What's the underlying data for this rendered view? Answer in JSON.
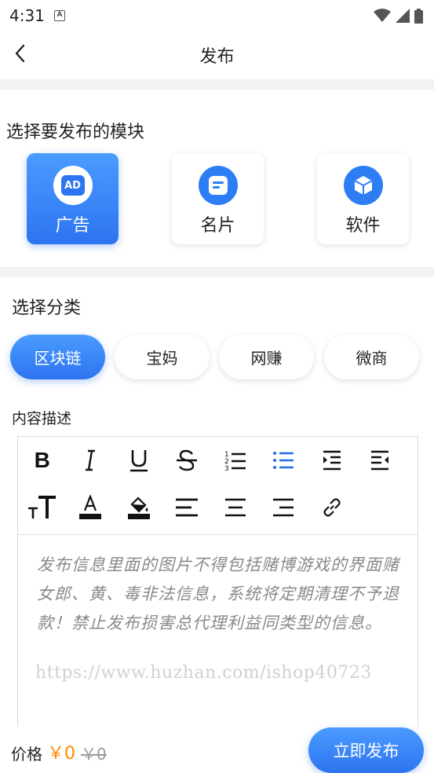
{
  "status_bar": {
    "time": "4:31",
    "notification_glyph": "A"
  },
  "header": {
    "title": "发布"
  },
  "module_section": {
    "title": "选择要发布的模块",
    "modules": [
      {
        "label": "广告",
        "icon": "ad-icon",
        "icon_text": "AD",
        "active": true
      },
      {
        "label": "名片",
        "icon": "card-icon",
        "active": false
      },
      {
        "label": "软件",
        "icon": "cube-icon",
        "active": false
      }
    ]
  },
  "category_section": {
    "title": "选择分类",
    "categories": [
      {
        "label": "区块链",
        "active": true
      },
      {
        "label": "宝妈",
        "active": false
      },
      {
        "label": "网赚",
        "active": false
      },
      {
        "label": "微商",
        "active": false
      }
    ]
  },
  "description": {
    "label": "内容描述",
    "toolbar_row1": [
      "bold-icon",
      "italic-icon",
      "underline-icon",
      "strikethrough-icon",
      "ordered-list-icon",
      "bullet-list-icon",
      "indent-icon",
      "outdent-icon"
    ],
    "toolbar_row2": [
      "font-size-icon",
      "font-color-icon",
      "fill-color-icon",
      "align-left-icon",
      "align-center-icon",
      "align-right-icon",
      "link-icon"
    ],
    "placeholder": "发布信息里面的图片不得包括赌博游戏的界面赌女郎、黄、毒非法信息，系统将定期清理不予退款！禁止发布损害总代理利益同类型的信息。",
    "watermark": "https://www.huzhan.com/ishop40723"
  },
  "bottom_bar": {
    "price_label": "价格",
    "price": "￥0",
    "original_price": "￥0",
    "publish_label": "立即发布"
  },
  "colors": {
    "accent": "#2d74f0",
    "accent_light": "#4a9bff",
    "price": "#ff8a00",
    "divider": "#f2f2f4"
  }
}
